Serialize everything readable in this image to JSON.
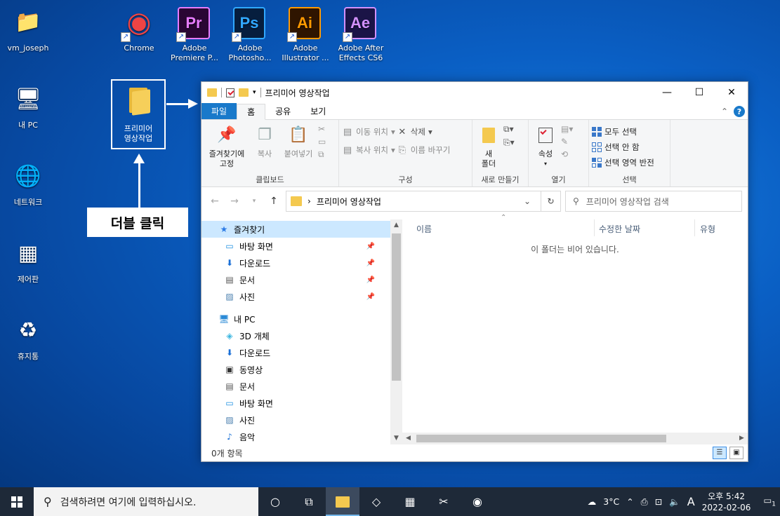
{
  "desktop": {
    "icons": [
      {
        "label": "vm_joseph",
        "icon": "user-folder-icon"
      },
      {
        "label": "Chrome",
        "icon": "chrome-icon"
      },
      {
        "label": "Adobe\nPremiere P...",
        "tile": "Pr",
        "bg": "#2a0634",
        "fg": "#e77cff"
      },
      {
        "label": "Adobe\nPhotosho...",
        "tile": "Ps",
        "bg": "#061e3e",
        "fg": "#31a8ff"
      },
      {
        "label": "Adobe\nIllustrator ...",
        "tile": "Ai",
        "bg": "#2f1500",
        "fg": "#ff9a00"
      },
      {
        "label": "Adobe After\nEffects CS6",
        "tile": "Ae",
        "bg": "#1b1447",
        "fg": "#d291ff"
      },
      {
        "label": "내 PC",
        "icon": "computer-icon"
      },
      {
        "label": "네트워크",
        "icon": "network-icon"
      },
      {
        "label": "제어판",
        "icon": "control-panel-icon"
      },
      {
        "label": "휴지통",
        "icon": "recycle-bin-icon"
      }
    ],
    "selected_folder": "프리미어\n영상작업",
    "callout": "더블 클릭"
  },
  "window": {
    "title": "프리미어 영상작업",
    "controls": {
      "minimize": "—",
      "maximize": "☐",
      "close": "✕"
    },
    "tabs": [
      "파일",
      "홈",
      "공유",
      "보기"
    ],
    "active_tab": "홈",
    "help": "?",
    "collapse": "⌃",
    "ribbon": {
      "clipboard": {
        "label": "클립보드",
        "pin": "즐겨찾기에\n고정",
        "copy": "복사",
        "paste": "붙여넣기"
      },
      "organize": {
        "label": "구성",
        "move_to": "이동 위치",
        "copy_to": "복사 위치",
        "delete": "삭제",
        "rename": "이름 바꾸기"
      },
      "new": {
        "label": "새로 만들기",
        "new_folder": "새\n폴더"
      },
      "open": {
        "label": "열기",
        "properties": "속성"
      },
      "select": {
        "label": "선택",
        "select_all": "모두 선택",
        "select_none": "선택 안 함",
        "invert": "선택 영역 반전"
      }
    },
    "address": {
      "path": "프리미어 영상작업",
      "separator": "›",
      "search_placeholder": "프리미어 영상작업 검색"
    },
    "nav": {
      "items": [
        {
          "label": "즐겨찾기",
          "icon": "star-icon",
          "level": 0,
          "selected": true,
          "pinned": false
        },
        {
          "label": "바탕 화면",
          "icon": "desktop-icon",
          "level": 1,
          "pinned": true
        },
        {
          "label": "다운로드",
          "icon": "download-icon",
          "level": 1,
          "pinned": true
        },
        {
          "label": "문서",
          "icon": "document-icon",
          "level": 1,
          "pinned": true
        },
        {
          "label": "사진",
          "icon": "picture-icon",
          "level": 1,
          "pinned": true
        },
        {
          "label": "",
          "spacer": true
        },
        {
          "label": "내 PC",
          "icon": "computer-icon",
          "level": 0
        },
        {
          "label": "3D 개체",
          "icon": "3d-object-icon",
          "level": 1
        },
        {
          "label": "다운로드",
          "icon": "download-icon",
          "level": 1
        },
        {
          "label": "동영상",
          "icon": "video-icon",
          "level": 1
        },
        {
          "label": "문서",
          "icon": "document-icon",
          "level": 1
        },
        {
          "label": "바탕 화면",
          "icon": "desktop-icon",
          "level": 1
        },
        {
          "label": "사진",
          "icon": "picture-icon",
          "level": 1
        },
        {
          "label": "음악",
          "icon": "music-icon",
          "level": 1
        }
      ]
    },
    "columns": [
      "이름",
      "수정한 날짜",
      "유형"
    ],
    "empty_message": "이 폴더는 비어 있습니다.",
    "status": "0개 항목"
  },
  "taskbar": {
    "search_placeholder": "검색하려면 여기에 입력하십시오.",
    "weather": "3°C",
    "ime": "A",
    "time": "오후 5:42",
    "date": "2022-02-06",
    "notification_count": "1"
  }
}
